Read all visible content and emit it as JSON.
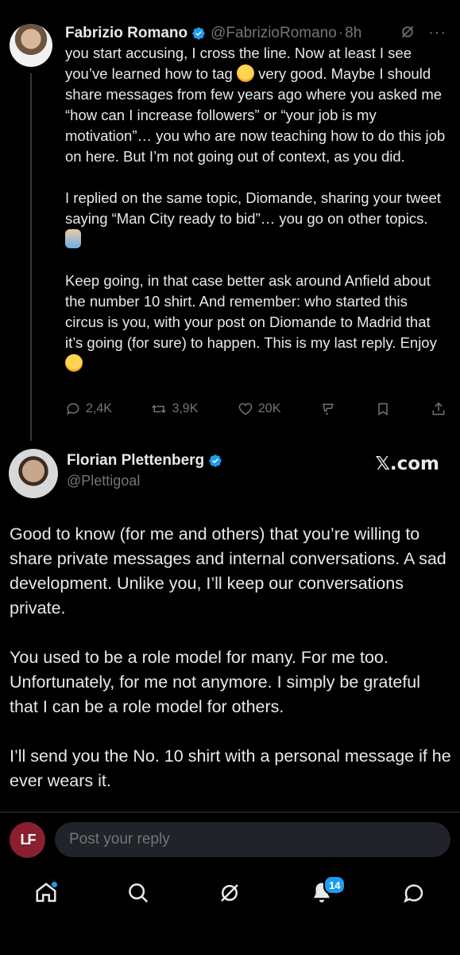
{
  "tweet1": {
    "author_name": "Fabrizio Romano",
    "handle": "@FabrizioRomano",
    "time": "8h",
    "paragraphs": [
      "you start accusing, I cross the line. Now at least I see you’ve learned how to tag",
      "very good. Maybe I should share messages from few years ago where you asked me “how can I increase followers” or “your job is my motivation”… you who are now teaching how to do this job on here. But I’m not going out of context, as you did.",
      "I replied on the same topic, Diomande, sharing your tweet saying “Man City ready to bid”… you go on other topics.",
      "Keep going, in that case better ask around Anfield about the number 10 shirt. And remember: who started this circus is you, with your post on Diomande to Madrid that it’s going (for sure) to happen. This is my last reply. Enjoy"
    ],
    "replies": "2,4K",
    "reposts": "3,9K",
    "likes": "20K"
  },
  "tweet2": {
    "author_name": "Florian Plettenberg",
    "handle": "@Plettigoal",
    "source_label": "𝕏.com",
    "paragraphs": [
      "Good to know (for me and others) that you’re willing to share private messages and internal conversations. A sad development. Unlike you, I’ll keep our conversations private.",
      "You used to be a role model for many. For me too. Unfortunately, for me not anymore. I simply be grateful that I can be a role model for others.",
      "I’ll send you the No. 10 shirt with a personal message if he ever wears it."
    ]
  },
  "reply": {
    "placeholder": "Post your reply",
    "avatar_text": "LF"
  },
  "nav": {
    "notifications_count": "14"
  },
  "colors": {
    "background": "#000000",
    "text": "#e7e9ea",
    "muted": "#71767b",
    "accent": "#1d9bf0"
  }
}
